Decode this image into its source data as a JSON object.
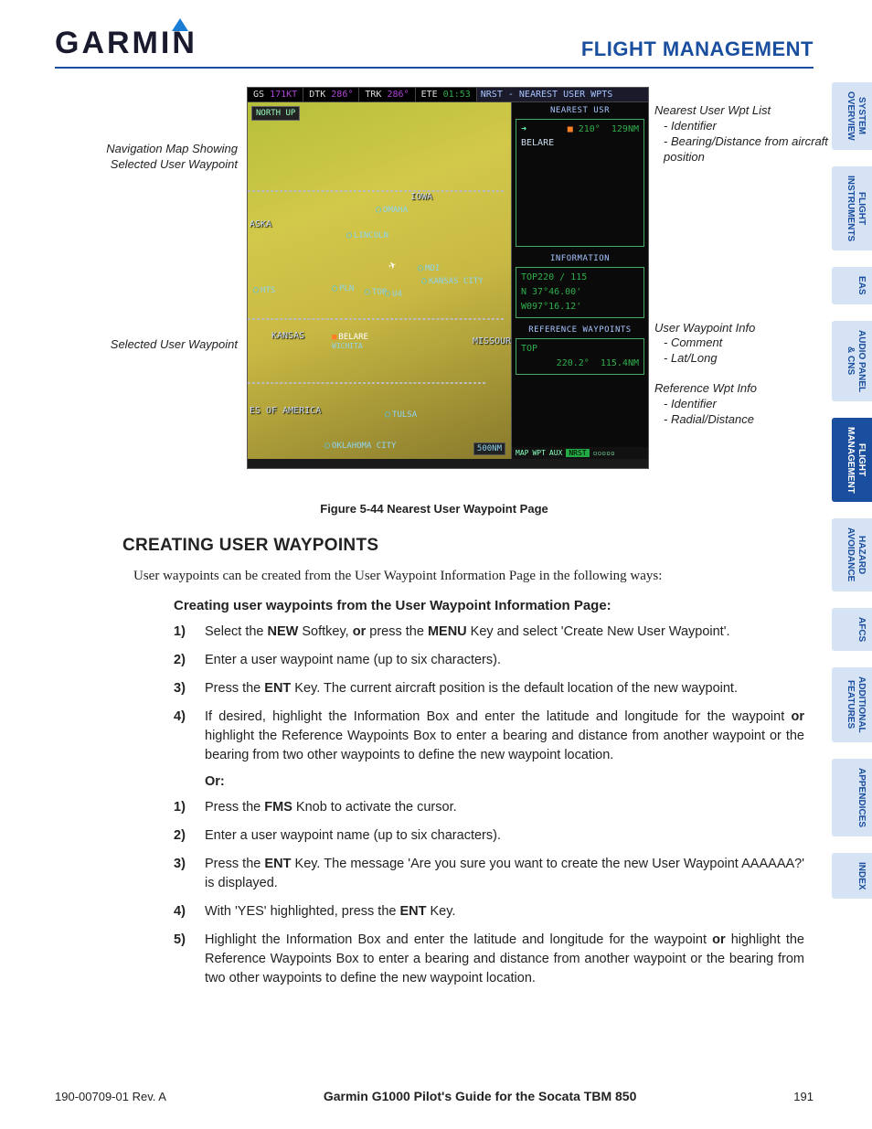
{
  "header": {
    "logo": "GARMIN",
    "section": "FLIGHT MANAGEMENT"
  },
  "tabs": [
    {
      "label": "SYSTEM\nOVERVIEW",
      "active": false
    },
    {
      "label": "FLIGHT\nINSTRUMENTS",
      "active": false
    },
    {
      "label": "EAS",
      "active": false
    },
    {
      "label": "AUDIO PANEL\n& CNS",
      "active": false
    },
    {
      "label": "FLIGHT\nMANAGEMENT",
      "active": true
    },
    {
      "label": "HAZARD\nAVOIDANCE",
      "active": false
    },
    {
      "label": "AFCS",
      "active": false
    },
    {
      "label": "ADDITIONAL\nFEATURES",
      "active": false
    },
    {
      "label": "APPENDICES",
      "active": false
    },
    {
      "label": "INDEX",
      "active": false
    }
  ],
  "figure": {
    "callouts_left": [
      "Navigation Map Showing Selected User Waypoint",
      "Selected User Waypoint"
    ],
    "callouts_right": [
      {
        "title": "Nearest User Wpt List",
        "subs": [
          "- Identifier",
          "- Bearing/Distance from aircraft position"
        ]
      },
      {
        "title": "User Waypoint Info",
        "subs": [
          "- Comment",
          "- Lat/Long"
        ]
      },
      {
        "title": "Reference Wpt Info",
        "subs": [
          "- Identifier",
          "- Radial/Distance"
        ]
      }
    ],
    "mfd_top": {
      "gs_label": "GS",
      "gs": "171KT",
      "dtk_label": "DTK",
      "dtk": "286°",
      "trk_label": "TRK",
      "trk": "286°",
      "ete_label": "ETE",
      "ete": "01:53",
      "page_title": "NRST - NEAREST USER WPTS"
    },
    "map": {
      "north": "NORTH UP",
      "states": [
        "IOWA",
        "ASKA",
        "KANSAS",
        "MISSOUR",
        "ES OF AMERICA"
      ],
      "cities": [
        "OMAHA",
        "LINCOLN",
        "KANSAS CITY",
        "TULSA",
        "OKLAHOMA CITY",
        "PLN",
        "TOP",
        "U4",
        "MDI",
        "HTS"
      ],
      "selected": "BELARE",
      "selected_below": "WICHITA",
      "scale": "500NM"
    },
    "panel": {
      "nearest_title": "NEAREST USR",
      "nearest_id": "BELARE",
      "nearest_brg": "210°",
      "nearest_dist": "129NM",
      "info_title": "INFORMATION",
      "info_comment": "TOP220 / 115",
      "info_lat": "N 37°46.00'",
      "info_lon": "W097°16.12'",
      "ref_title": "REFERENCE WAYPOINTS",
      "ref_id": "TOP",
      "ref_radial": "220.2°",
      "ref_dist": "115.4NM",
      "foot": [
        "MAP",
        "WPT",
        "AUX",
        "NRST"
      ]
    },
    "caption": "Figure 5-44  Nearest User Waypoint Page"
  },
  "content": {
    "heading": "CREATING USER WAYPOINTS",
    "intro": "User waypoints can be created from the User Waypoint Information Page in the following ways:",
    "sub": "Creating user waypoints from the User Waypoint Information Page:",
    "steps1": [
      [
        "Select the ",
        "NEW",
        " Softkey, ",
        "or",
        " press the ",
        "MENU",
        " Key and select 'Create New User Waypoint'."
      ],
      [
        "Enter a user waypoint name (up to six characters)."
      ],
      [
        "Press the ",
        "ENT",
        " Key.  The current aircraft position is the default location of the new waypoint."
      ],
      [
        "If desired, highlight the Information Box and enter the latitude and longitude for the waypoint ",
        "or",
        " highlight the Reference Waypoints Box to enter a bearing and distance from another waypoint or the bearing from two other waypoints to define the new waypoint location."
      ]
    ],
    "or": "Or:",
    "steps2": [
      [
        "Press the ",
        "FMS",
        " Knob to activate the cursor."
      ],
      [
        "Enter a user waypoint name (up to six characters)."
      ],
      [
        "Press the ",
        "ENT",
        " Key.  The message 'Are you sure you want to create the new User Waypoint AAAAAA?' is displayed."
      ],
      [
        "With 'YES' highlighted, press the ",
        "ENT",
        " Key."
      ],
      [
        "Highlight the Information Box and enter the latitude and longitude for the waypoint ",
        "or",
        " highlight the Reference Waypoints Box to enter a bearing and distance from another waypoint or the bearing from two other waypoints to define the new waypoint location."
      ]
    ]
  },
  "footer": {
    "left": "190-00709-01  Rev. A",
    "center": "Garmin G1000 Pilot's Guide for the Socata TBM 850",
    "right": "191"
  }
}
